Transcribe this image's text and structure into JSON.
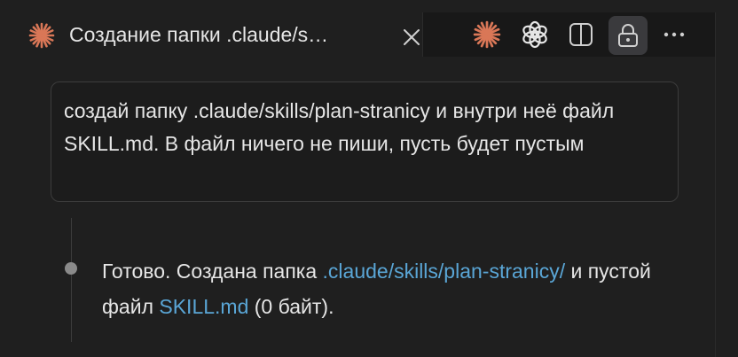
{
  "tab": {
    "title": "Создание папки .claude/s…",
    "icon": "claude-sparkle-icon",
    "close_icon": "close-icon"
  },
  "actions": [
    {
      "name": "claude-sparkle-icon"
    },
    {
      "name": "openai-icon"
    },
    {
      "name": "split-editor-icon"
    },
    {
      "name": "lock-icon",
      "active": true
    },
    {
      "name": "more-icon"
    }
  ],
  "prompt": {
    "text": "создай папку .claude/skills/plan-stranicy и внутри неё файл SKILL.md. В файл ничего не пиши, пусть будет пустым"
  },
  "response": {
    "part1": "Готово. Создана папка ",
    "folder_link": ".claude/skills/plan-stranicy/",
    "part2": " и пустой файл ",
    "file_link": "SKILL.md",
    "part3": " (0 байт)."
  },
  "colors": {
    "background": "#1f1f1f",
    "accent_orange": "#d97757",
    "link": "#5aa6d6",
    "active_button": "#3a3a3d"
  }
}
